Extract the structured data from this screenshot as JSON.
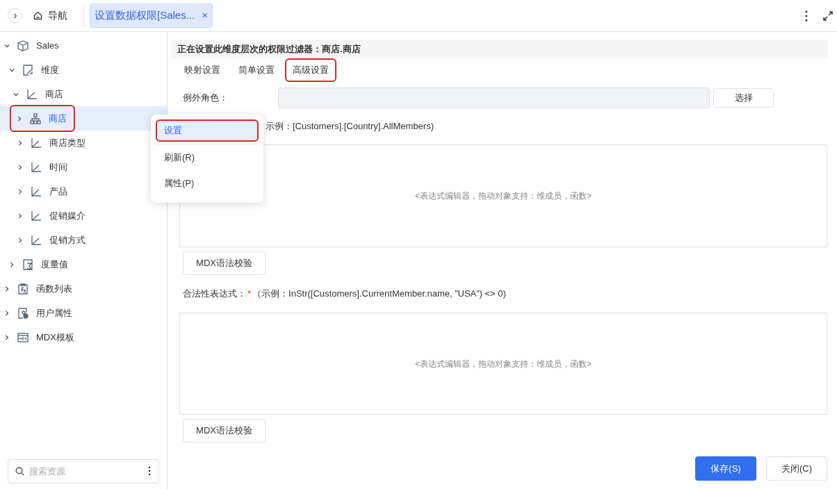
{
  "top_bar": {
    "nav_label": "导航",
    "tabs": [
      {
        "label": "设置数据权限[Sales...",
        "close": "×",
        "selected": true
      }
    ]
  },
  "tree": [
    {
      "label": "Sales",
      "kind": "cube",
      "expanded": true,
      "selected": false,
      "highlighted": false,
      "children": [
        {
          "label": "维度",
          "kind": "dimension",
          "expanded": true,
          "selected": false,
          "highlighted": false,
          "children": [
            {
              "label": "商店",
              "kind": "level",
              "expanded": true,
              "selected": false,
              "highlighted": false,
              "children": [
                {
                  "label": "商店",
                  "kind": "hierarchy",
                  "expanded": false,
                  "selected": true,
                  "highlighted": true
                },
                {
                  "label": "商店类型",
                  "kind": "level",
                  "expanded": false,
                  "selected": false,
                  "highlighted": false
                },
                {
                  "label": "时间",
                  "kind": "level",
                  "expanded": false,
                  "selected": false,
                  "highlighted": false
                },
                {
                  "label": "产品",
                  "kind": "level",
                  "expanded": false,
                  "selected": false,
                  "highlighted": false
                },
                {
                  "label": "促销媒介",
                  "kind": "level",
                  "expanded": false,
                  "selected": false,
                  "highlighted": false
                },
                {
                  "label": "促销方式",
                  "kind": "level",
                  "expanded": false,
                  "selected": false,
                  "highlighted": false
                }
              ]
            }
          ]
        },
        {
          "label": "度量值",
          "kind": "measure",
          "expanded": false,
          "selected": false,
          "highlighted": false
        }
      ]
    },
    {
      "label": "函数列表",
      "kind": "function",
      "expanded": false,
      "selected": false,
      "highlighted": false
    },
    {
      "label": "用户属性",
      "kind": "user",
      "expanded": false,
      "selected": false,
      "highlighted": false
    },
    {
      "label": "MDX模板",
      "kind": "mdx",
      "expanded": false,
      "selected": false,
      "highlighted": false
    }
  ],
  "search": {
    "placeholder": "搜索资源"
  },
  "context_menu": [
    {
      "label": "设置",
      "selected": true,
      "highlighted": true
    },
    {
      "label": "刷新(R)",
      "selected": false,
      "highlighted": false
    },
    {
      "label": "属性(P)",
      "selected": false,
      "highlighted": false
    }
  ],
  "panel": {
    "header": "正在设置此维度层次的权限过滤器：商店.商店",
    "tabs": [
      {
        "label": "映射设置",
        "highlighted": false
      },
      {
        "label": "简单设置",
        "highlighted": false
      },
      {
        "label": "高级设置",
        "highlighted": true
      }
    ],
    "exception_role": {
      "label": "例外角色：",
      "button": "选择"
    },
    "expression_hint": "示例：[Customers].[Country].AllMembers)",
    "editor1_placeholder": "<表达式编辑器，拖动对象支持：维成员，函数>",
    "check_button1": "MDX语法校验",
    "validity_label": "合法性表达式：",
    "required_mark": "*",
    "validity_hint": "（示例：InStr([Customers].CurrentMember.name, ”USA”) <> 0)",
    "editor2_placeholder": "<表达式编辑器，拖动对象支持：维成员，函数>",
    "check_button2": "MDX语法校验",
    "save_button": "保存(S)",
    "close_button": "关闭(C)"
  }
}
